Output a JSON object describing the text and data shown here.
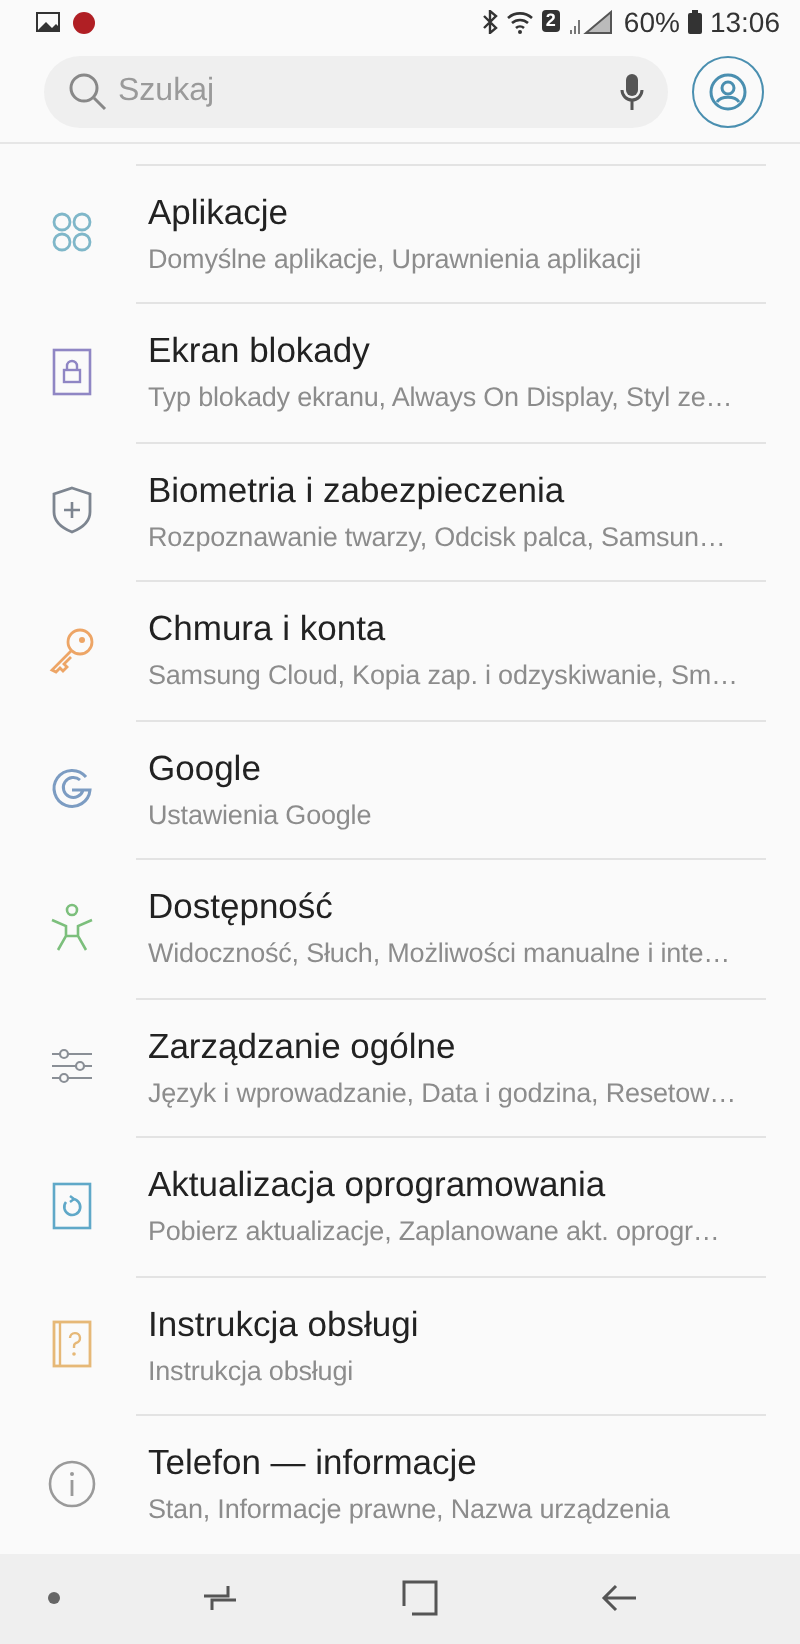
{
  "status_bar": {
    "network_badge": "2",
    "battery": "60%",
    "time": "13:06"
  },
  "search": {
    "placeholder": "Szukaj"
  },
  "items": [
    {
      "kind": "apps",
      "color": "#7fb7c9",
      "title": "Aplikacje",
      "subtitle": "Domyślne aplikacje, Uprawnienia aplikacji"
    },
    {
      "kind": "lock",
      "color": "#8f86c4",
      "title": "Ekran blokady",
      "subtitle": "Typ blokady ekranu, Always On Display, Styl ze…"
    },
    {
      "kind": "shield",
      "color": "#7d8590",
      "title": "Biometria i zabezpieczenia",
      "subtitle": "Rozpoznawanie twarzy, Odcisk palca, Samsun…"
    },
    {
      "kind": "key",
      "color": "#eda566",
      "title": "Chmura i konta",
      "subtitle": "Samsung Cloud, Kopia zap. i odzyskiwanie, Sm…"
    },
    {
      "kind": "google",
      "color": "#7c9cc2",
      "title": "Google",
      "subtitle": "Ustawienia Google"
    },
    {
      "kind": "person",
      "color": "#7cbf7c",
      "title": "Dostępność",
      "subtitle": "Widoczność, Słuch, Możliwości manualne i inte…"
    },
    {
      "kind": "sliders",
      "color": "#8a8f96",
      "title": "Zarządzanie ogólne",
      "subtitle": "Język i wprowadzanie, Data i godzina, Resetow…"
    },
    {
      "kind": "update",
      "color": "#5fa8c8",
      "title": "Aktualizacja oprogramowania",
      "subtitle": "Pobierz aktualizacje, Zaplanowane akt. oprogr…"
    },
    {
      "kind": "manual",
      "color": "#e6b877",
      "title": "Instrukcja obsługi",
      "subtitle": "Instrukcja obsługi"
    },
    {
      "kind": "info",
      "color": "#9a9a9a",
      "title": "Telefon — informacje",
      "subtitle": "Stan, Informacje prawne, Nazwa urządzenia"
    }
  ]
}
